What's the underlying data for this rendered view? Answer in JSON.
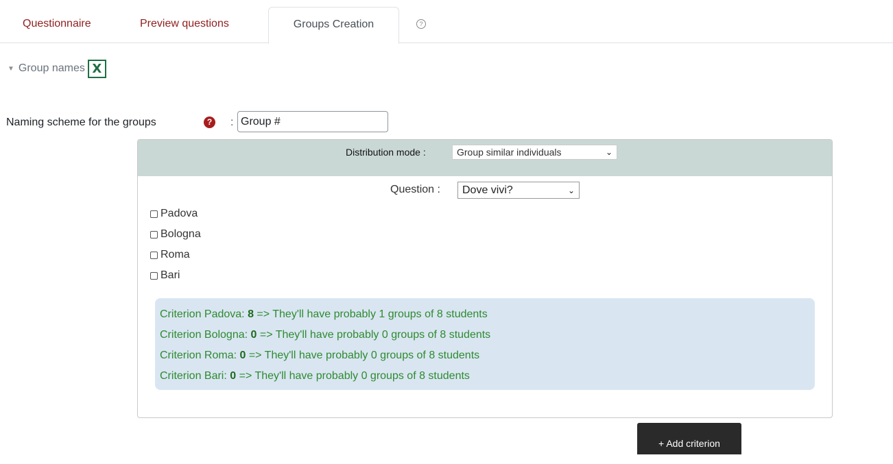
{
  "tabs": [
    {
      "label": "Questionnaire"
    },
    {
      "label": "Preview questions"
    },
    {
      "label": "Groups Creation"
    },
    {
      "label": "?",
      "icon": "help-icon"
    }
  ],
  "section": {
    "title": "Group names",
    "icon": "excel-icon",
    "icon_letter": "X"
  },
  "naming": {
    "label": "Naming scheme for the groups",
    "help_icon": "?",
    "colon": ":",
    "value": "Group #"
  },
  "distribution": {
    "label": "Distribution mode :",
    "selected": "Group similar individuals"
  },
  "question": {
    "label": "Question :",
    "selected": "Dove vivi?"
  },
  "options": [
    "Padova",
    "Bologna",
    "Roma",
    "Bari"
  ],
  "results": [
    {
      "prefix": "Criterion Padova: ",
      "count": "8",
      "suffix": " => They'll have probably 1 groups of 8 students"
    },
    {
      "prefix": "Criterion Bologna: ",
      "count": "0",
      "suffix": " => They'll have probably 0 groups of 8 students"
    },
    {
      "prefix": "Criterion Roma: ",
      "count": "0",
      "suffix": " => They'll have probably 0 groups of 8 students"
    },
    {
      "prefix": "Criterion Bari: ",
      "count": "0",
      "suffix": " => They'll have probably 0 groups of 8 students"
    }
  ],
  "add_button": "+ Add criterion",
  "colors": {
    "tab_link": "#8f1e1e",
    "dist_bar": "#c9d8d5",
    "results_bg": "#d9e6f2",
    "results_text": "#2f8a2f",
    "button_bg": "#2a2a2a"
  }
}
